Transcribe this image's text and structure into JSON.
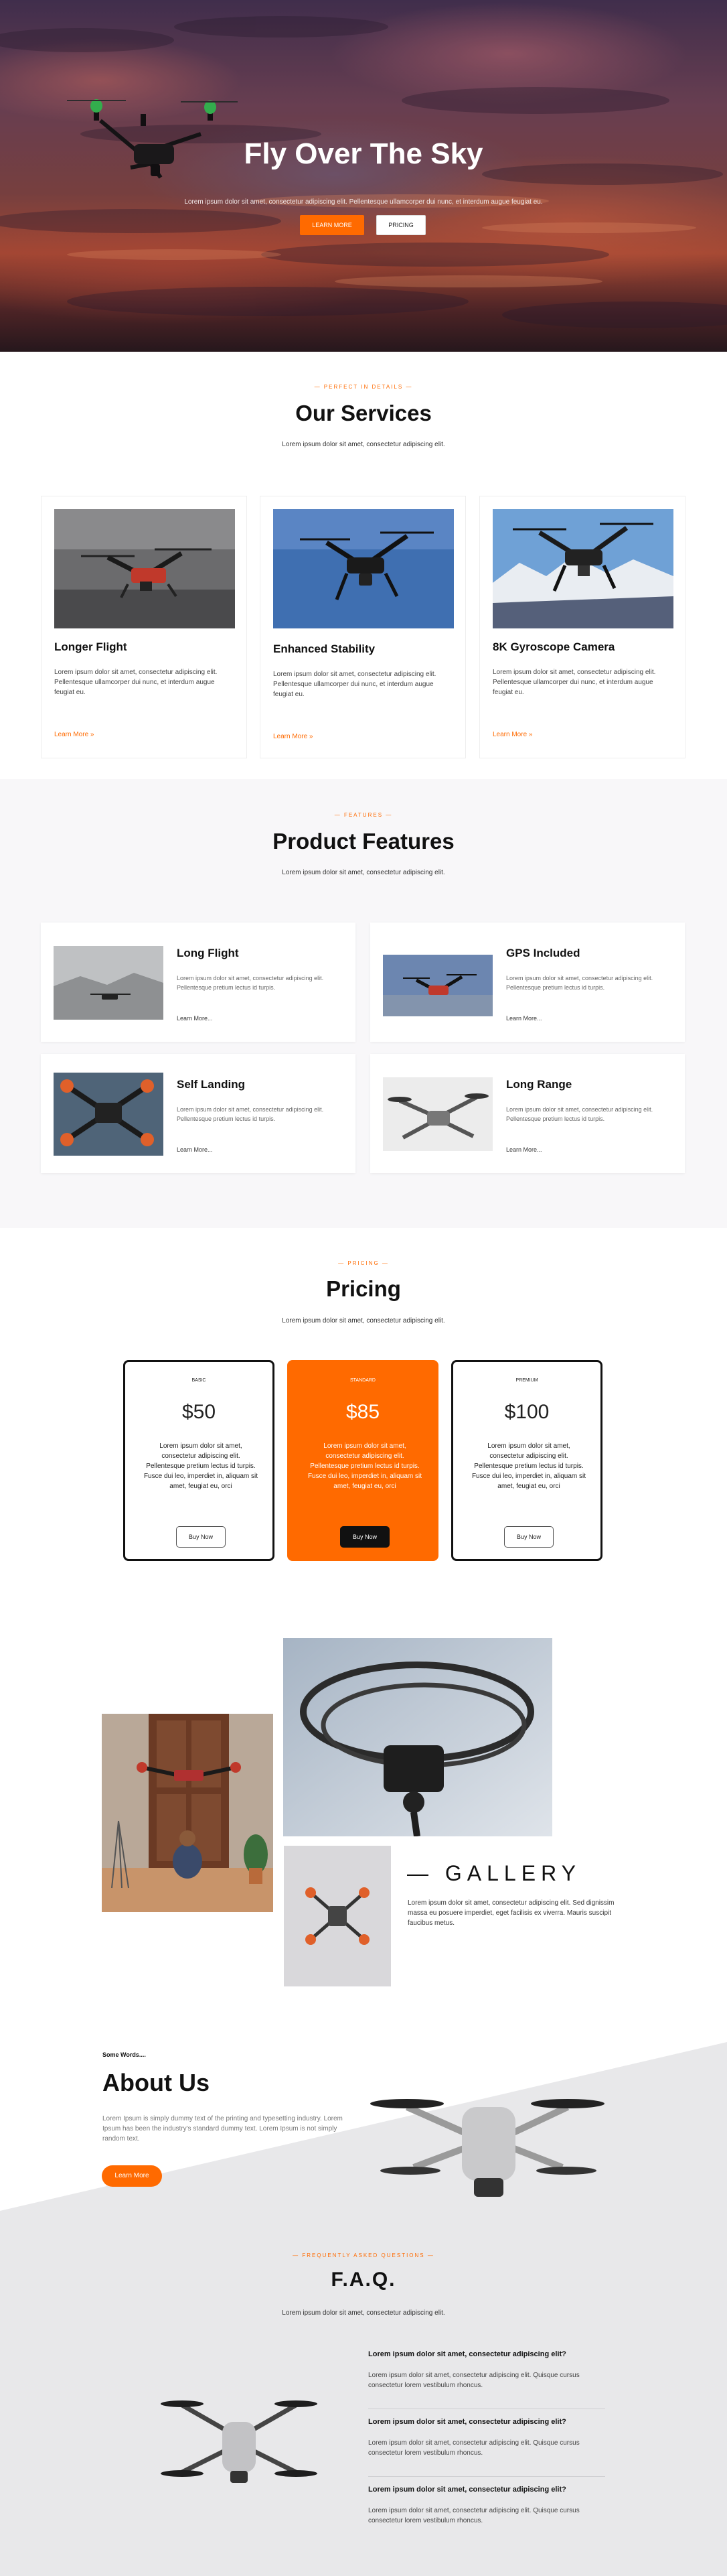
{
  "hero": {
    "title": "Fly Over The Sky",
    "subtitle": "Lorem ipsum dolor sit amet, consectetur adipiscing elit. Pellentesque ullamcorper dui nunc, et interdum augue feugiat eu.",
    "btn_learn": "LEARN MORE",
    "btn_pricing": "PRICING"
  },
  "services": {
    "eyebrow": "— PERFECT IN DETAILS —",
    "title": "Our Services",
    "subtitle": "Lorem ipsum dolor sit amet, consectetur adipiscing elit.",
    "cards": [
      {
        "title": "Longer Flight",
        "text": "Lorem ipsum dolor sit amet, consectetur adipiscing elit. Pellentesque ullamcorper dui nunc, et interdum augue feugiat eu.",
        "link": "Learn More »"
      },
      {
        "title": "Enhanced Stability",
        "text": "Lorem ipsum dolor sit amet, consectetur adipiscing elit. Pellentesque ullamcorper dui nunc, et interdum augue feugiat eu.",
        "link": "Learn More »"
      },
      {
        "title": "8K Gyroscope Camera",
        "text": "Lorem ipsum dolor sit amet, consectetur adipiscing elit. Pellentesque ullamcorper dui nunc, et interdum augue feugiat eu.",
        "link": "Learn More »"
      }
    ]
  },
  "features": {
    "eyebrow": "— FEATURES —",
    "title": "Product Features",
    "subtitle": "Lorem ipsum dolor sit amet, consectetur adipiscing elit.",
    "cards": [
      {
        "title": "Long Flight",
        "text": "Lorem ipsum dolor sit amet, consectetur adipiscing elit. Pellentesque pretium lectus id turpis.",
        "link": "Learn More..."
      },
      {
        "title": "GPS Included",
        "text": "Lorem ipsum dolor sit amet, consectetur adipiscing elit. Pellentesque pretium lectus id turpis.",
        "link": "Learn More..."
      },
      {
        "title": "Self Landing",
        "text": "Lorem ipsum dolor sit amet, consectetur adipiscing elit. Pellentesque pretium lectus id turpis.",
        "link": "Learn More..."
      },
      {
        "title": "Long Range",
        "text": "Lorem ipsum dolor sit amet, consectetur adipiscing elit. Pellentesque pretium lectus id turpis.",
        "link": "Learn More..."
      }
    ]
  },
  "pricing": {
    "eyebrow": "— PRICING —",
    "title": "Pricing",
    "subtitle": "Lorem ipsum dolor sit amet, consectetur adipiscing elit.",
    "plans": [
      {
        "tier": "BASIC",
        "price": "$50",
        "desc": "Lorem ipsum dolor sit amet, consectetur adipiscing elit. Pellentesque pretium lectus id turpis. Fusce dui leo, imperdiet in, aliquam sit amet, feugiat eu, orci",
        "button": "Buy Now"
      },
      {
        "tier": "STANDARD",
        "price": "$85",
        "desc": "Lorem ipsum dolor sit amet, consectetur adipiscing elit. Pellentesque pretium lectus id turpis. Fusce dui leo, imperdiet in, aliquam sit amet, feugiat eu, orci",
        "button": "Buy Now"
      },
      {
        "tier": "PREMIUM",
        "price": "$100",
        "desc": "Lorem ipsum dolor sit amet, consectetur adipiscing elit. Pellentesque pretium lectus id turpis. Fusce dui leo, imperdiet in, aliquam sit amet, feugiat eu, orci",
        "button": "Buy Now"
      }
    ]
  },
  "gallery": {
    "title": "— GALLERY",
    "text": "Lorem ipsum dolor sit amet, consectetur adipiscing elit. Sed dignissim massa eu posuere imperdiet, eget facilisis ex viverra. Mauris suscipit faucibus metus."
  },
  "about": {
    "kicker": "Some Words....",
    "title": "About Us",
    "text": "Lorem Ipsum is simply dummy text of the printing and typesetting industry. Lorem Ipsum has been the industry's standard dummy text. Lorem Ipsum is not simply random text.",
    "button": "Learn More"
  },
  "faq": {
    "eyebrow": "— FREQUENTLY ASKED QUESTIONS —",
    "title": "F.A.Q.",
    "subtitle": "Lorem ipsum dolor sit amet, consectetur adipiscing elit.",
    "items": [
      {
        "q": "Lorem ipsum dolor sit amet, consectetur adipiscing elit?",
        "a": "Lorem ipsum dolor sit amet, consectetur adipiscing elit. Quisque cursus consectetur lorem vestibulum rhoncus."
      },
      {
        "q": "Lorem ipsum dolor sit amet, consectetur adipiscing elit?",
        "a": "Lorem ipsum dolor sit amet, consectetur adipiscing elit. Quisque cursus consectetur lorem vestibulum rhoncus."
      },
      {
        "q": "Lorem ipsum dolor sit amet, consectetur adipiscing elit?",
        "a": "Lorem ipsum dolor sit amet, consectetur adipiscing elit. Quisque cursus consectetur lorem vestibulum rhoncus."
      }
    ]
  },
  "colors": {
    "accent": "#ff6a00",
    "dark": "#111111",
    "light_bg": "#f8f7f9",
    "faq_bg": "#e8e8ea"
  },
  "icons": [
    "drone-image",
    "drone-icon"
  ]
}
